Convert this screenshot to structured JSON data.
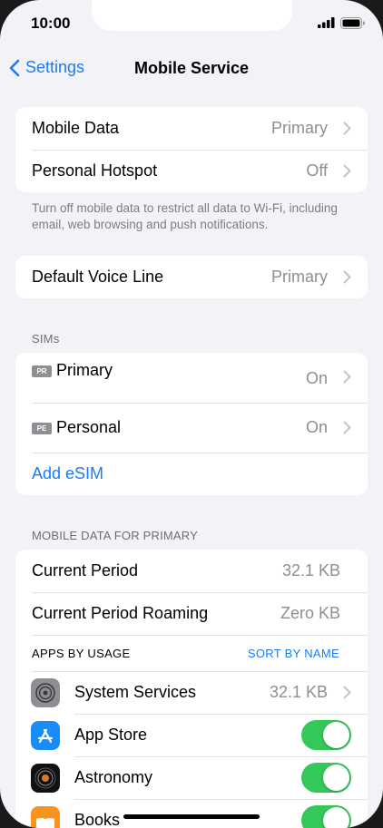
{
  "status_bar": {
    "time": "10:00"
  },
  "nav": {
    "back_label": "Settings",
    "title": "Mobile Service"
  },
  "group1": [
    {
      "label": "Mobile Data",
      "value": "Primary"
    },
    {
      "label": "Personal Hotspot",
      "value": "Off"
    }
  ],
  "group1_footer": "Turn off mobile data to restrict all data to Wi-Fi, including email, web browsing and push notifications.",
  "voice": {
    "label": "Default Voice Line",
    "value": "Primary"
  },
  "sims": {
    "header": "SIMs",
    "items": [
      {
        "badge": "PR",
        "label": "Primary",
        "value": "On"
      },
      {
        "badge": "PE",
        "label": "Personal",
        "value": "On"
      }
    ],
    "add_label": "Add eSIM"
  },
  "usage": {
    "header": "MOBILE DATA FOR PRIMARY",
    "current_period": {
      "label": "Current Period",
      "value": "32.1 KB"
    },
    "roaming": {
      "label": "Current Period Roaming",
      "value": "Zero KB"
    },
    "apps_header": "APPS BY USAGE",
    "sort_label": "SORT BY NAME",
    "apps": [
      {
        "name": "System Services",
        "value": "32.1 KB",
        "icon": "gear-icon"
      },
      {
        "name": "App Store",
        "icon": "app-store-icon",
        "toggle": "on"
      },
      {
        "name": "Astronomy",
        "icon": "astronomy-icon",
        "toggle": "on"
      },
      {
        "name": "Books",
        "icon": "books-icon",
        "toggle": "on"
      }
    ]
  },
  "colors": {
    "accent": "#1a7cf5",
    "toggle_on": "#34c759",
    "background": "#f2f2f7"
  }
}
